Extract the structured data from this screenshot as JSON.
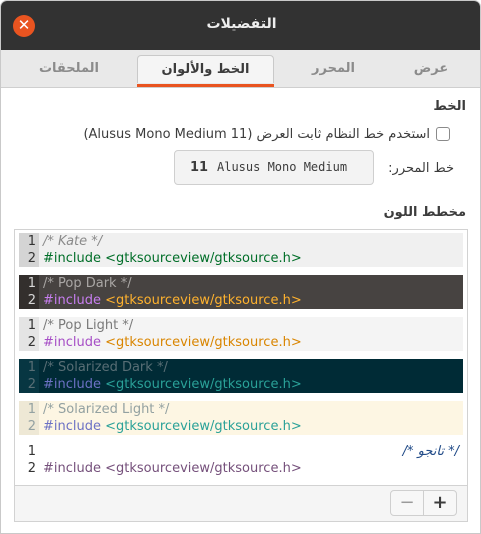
{
  "window": {
    "title": "التفضيلات"
  },
  "tabs": [
    {
      "label": "عرض"
    },
    {
      "label": "المحرر"
    },
    {
      "label": "الخط والألوان"
    },
    {
      "label": "الملحقات"
    }
  ],
  "font_section": {
    "heading": "الخط",
    "use_system_font_label": "استخدم خط النظام ثابت العرض (Alusus Mono Medium 11)",
    "use_system_font_checked": false,
    "editor_font_label": "خط المحرر:",
    "font_size": "11",
    "font_name": "Alusus Mono Medium"
  },
  "scheme_section": {
    "heading": "مخطط اللون",
    "line_numbers": [
      "1",
      "2"
    ],
    "schemes": [
      {
        "comment": "/* Kate */",
        "include_kw": "#include",
        "include_path": "<gtksourceview/gtksource.h>"
      },
      {
        "comment": "/* Pop Dark */",
        "include_kw": "#include",
        "include_path": "<gtksourceview/gtksource.h>"
      },
      {
        "comment": "/* Pop Light */",
        "include_kw": "#include",
        "include_path": "<gtksourceview/gtksource.h>"
      },
      {
        "comment": "/* Solarized Dark */",
        "include_kw": "#include",
        "include_path": "<gtksourceview/gtksource.h>"
      },
      {
        "comment": "/* Solarized Light */",
        "include_kw": "#include",
        "include_path": "<gtksourceview/gtksource.h>"
      },
      {
        "comment": "/* تانجو */",
        "include_kw": "#include",
        "include_path": "<gtksourceview/gtksource.h>"
      }
    ],
    "remove_label": "−",
    "add_label": "+"
  },
  "colors": {
    "accent": "#e95420",
    "titlebar": "#323232"
  }
}
